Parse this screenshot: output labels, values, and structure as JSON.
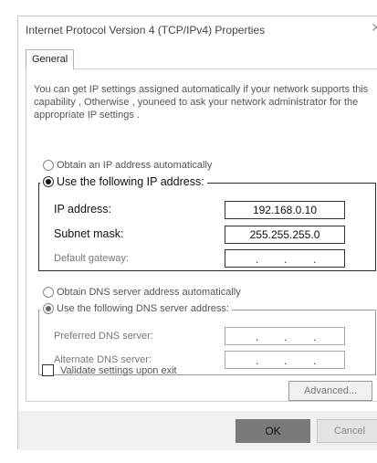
{
  "window": {
    "title": "Internet Protocol Version 4 (TCP/IPv4) Properties",
    "close_icon": "close-icon",
    "close_glyph": "✕"
  },
  "tabs": [
    {
      "label": "General"
    }
  ],
  "description": "You can get IP settings assigned automatically if your network supports this capability , Otherwise , youneed to ask your network administrator for the appropriate IP settings .",
  "ip": {
    "auto_label": "Obtain an IP address automatically",
    "manual_label": "Use the following IP address:",
    "selected": "manual",
    "fields": [
      {
        "label": "IP address:",
        "value": "192.168.0.10"
      },
      {
        "label": "Subnet mask:",
        "value": "255.255.255.0"
      },
      {
        "label": "Default gateway:",
        "value": ". . ."
      }
    ]
  },
  "dns": {
    "auto_label": "Obtain DNS server address automatically",
    "manual_label": "Use the following DNS server address:",
    "selected": "manual",
    "fields": [
      {
        "label": "Preferred DNS server:",
        "value": ". . ."
      },
      {
        "label": "Alternate DNS server:",
        "value": ". . ."
      }
    ]
  },
  "validate": {
    "label": "Validate settings upon exit",
    "checked": false
  },
  "buttons": {
    "advanced": "Advanced...",
    "ok": "OK",
    "cancel": "Cancel"
  }
}
